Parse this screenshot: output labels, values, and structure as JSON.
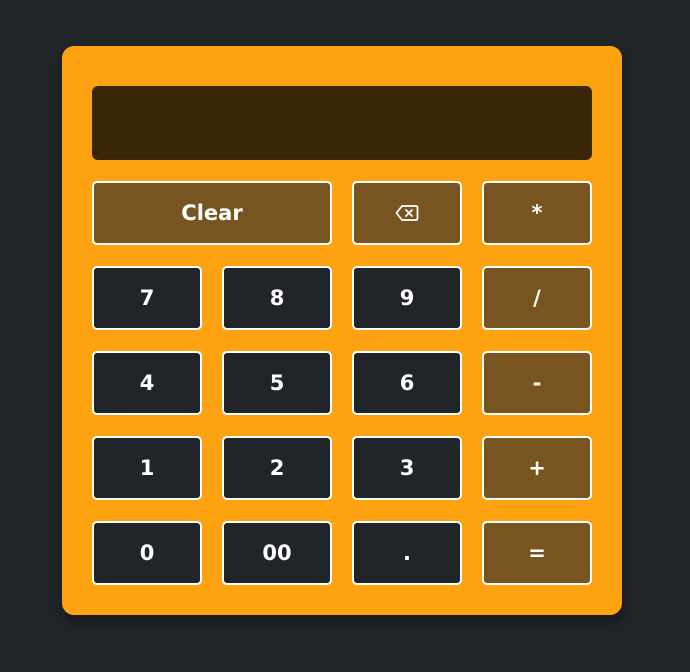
{
  "display": {
    "value": ""
  },
  "keys": {
    "clear": "Clear",
    "backspace_icon": "backspace-icon",
    "multiply": "*",
    "seven": "7",
    "eight": "8",
    "nine": "9",
    "divide": "/",
    "four": "4",
    "five": "5",
    "six": "6",
    "subtract": "-",
    "one": "1",
    "two": "2",
    "three": "3",
    "add": "+",
    "zero": "0",
    "double_zero": "00",
    "decimal": ".",
    "equals": "="
  },
  "colors": {
    "page_background": "#212429",
    "calculator_body": "#FDA210",
    "display_background": "#3A2604",
    "number_key": "#212429",
    "operator_key": "#785520",
    "key_border": "#ffffff"
  }
}
